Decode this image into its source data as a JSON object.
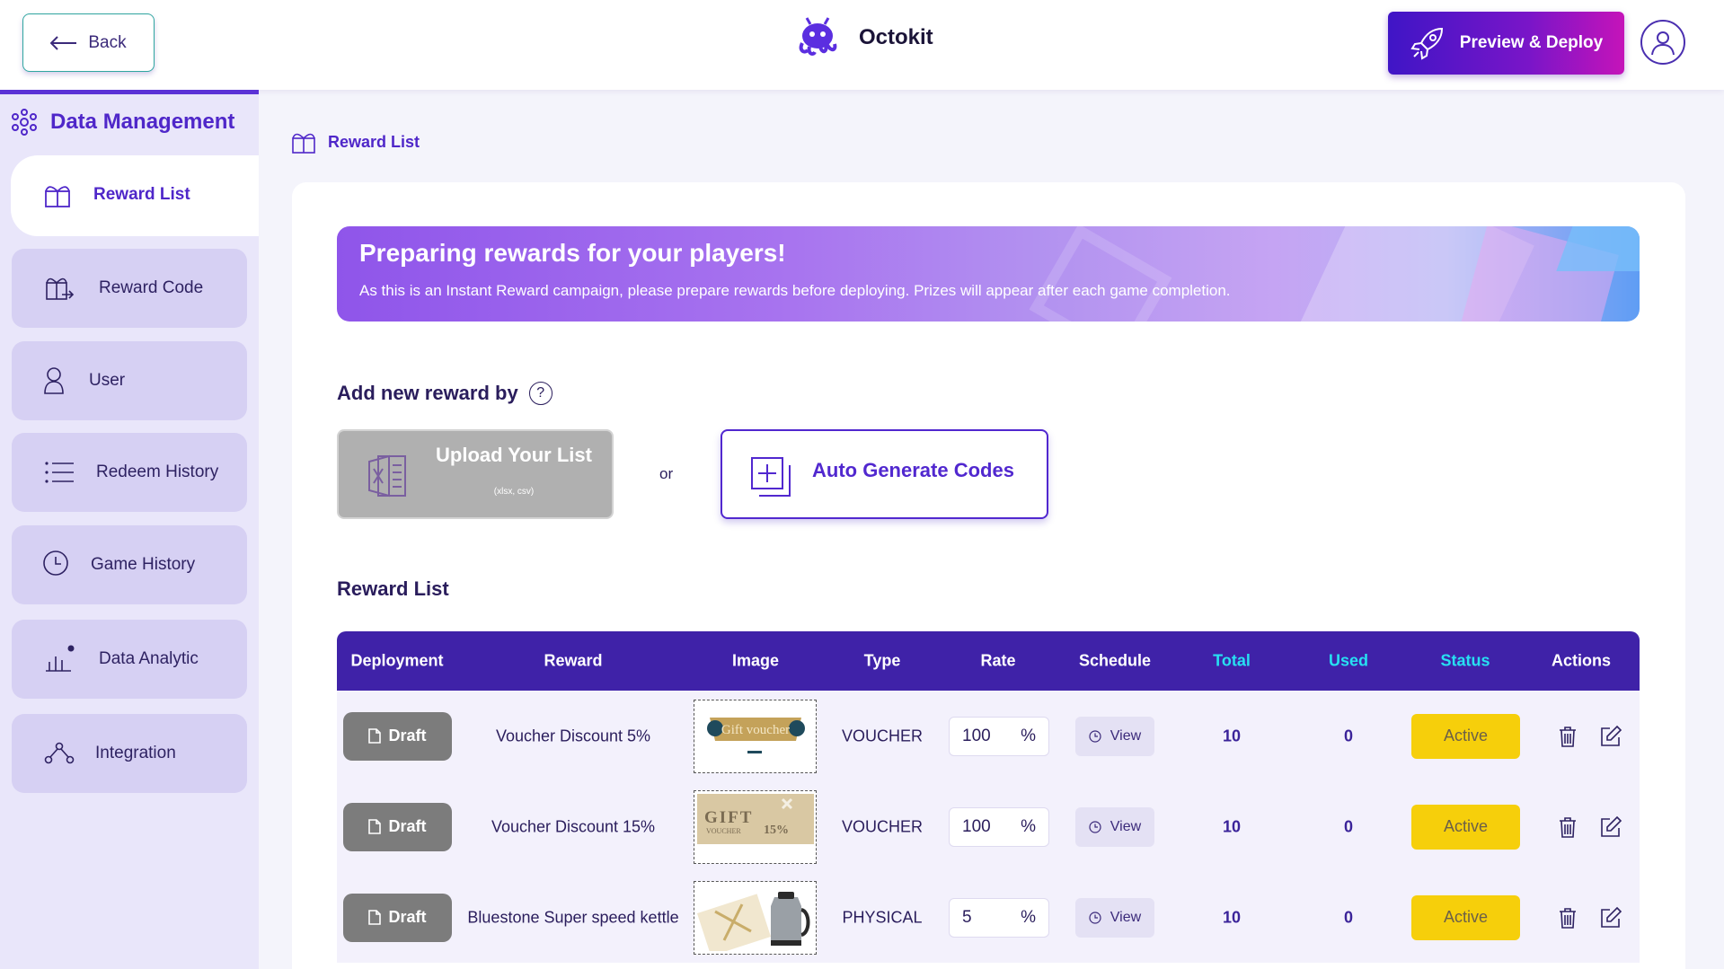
{
  "header": {
    "back_label": "Back",
    "brand_name": "Octokit",
    "deploy_label": "Preview & Deploy"
  },
  "sidebar": {
    "title": "Data Management",
    "items": [
      {
        "label": "Reward List",
        "icon": "gift-icon",
        "active": true
      },
      {
        "label": "Reward Code",
        "icon": "gift-code-icon"
      },
      {
        "label": "User",
        "icon": "user-icon"
      },
      {
        "label": "Redeem History",
        "icon": "list-icon"
      },
      {
        "label": "Game History",
        "icon": "clock-icon"
      },
      {
        "label": "Data Analytic",
        "icon": "chart-icon"
      },
      {
        "label": "Integration",
        "icon": "nodes-icon"
      }
    ]
  },
  "breadcrumb": {
    "label": "Reward List"
  },
  "banner": {
    "title": "Preparing rewards for your players!",
    "subtitle": "As this is an Instant Reward campaign, please prepare rewards before deploying. Prizes will appear after each game completion."
  },
  "add_reward": {
    "title": "Add new reward by",
    "help": "?",
    "upload_title": "Upload Your List",
    "upload_sub": "(xlsx, csv)",
    "or": "or",
    "autogen_label": "Auto Generate Codes"
  },
  "reward_list": {
    "title": "Reward List",
    "columns": [
      "Deployment",
      "Reward",
      "Image",
      "Type",
      "Rate",
      "Schedule",
      "Total",
      "Used",
      "Status",
      "Actions"
    ],
    "rows": [
      {
        "deployment": "Draft",
        "reward": "Voucher Discount 5%",
        "type": "VOUCHER",
        "rate": "100",
        "rate_unit": "%",
        "schedule": "View",
        "total": "10",
        "used": "0",
        "status": "Active"
      },
      {
        "deployment": "Draft",
        "reward": "Voucher Discount 15%",
        "type": "VOUCHER",
        "rate": "100",
        "rate_unit": "%",
        "schedule": "View",
        "total": "10",
        "used": "0",
        "status": "Active"
      },
      {
        "deployment": "Draft",
        "reward": "Bluestone Super speed kettle",
        "type": "PHYSICAL",
        "rate": "5",
        "rate_unit": "%",
        "schedule": "View",
        "total": "10",
        "used": "0",
        "status": "Active"
      }
    ]
  },
  "images": {
    "voucher1_text": "Gift voucher",
    "voucher2_text": "GIFT",
    "voucher2_sub": "VOUCHER",
    "voucher2_pct": "15%"
  },
  "colors": {
    "accent": "#4f27c9",
    "table_header": "#3f22a8",
    "status_active": "#f6cf0b",
    "draft": "#7c7c7c",
    "highlight_header": "#27e0f2"
  }
}
